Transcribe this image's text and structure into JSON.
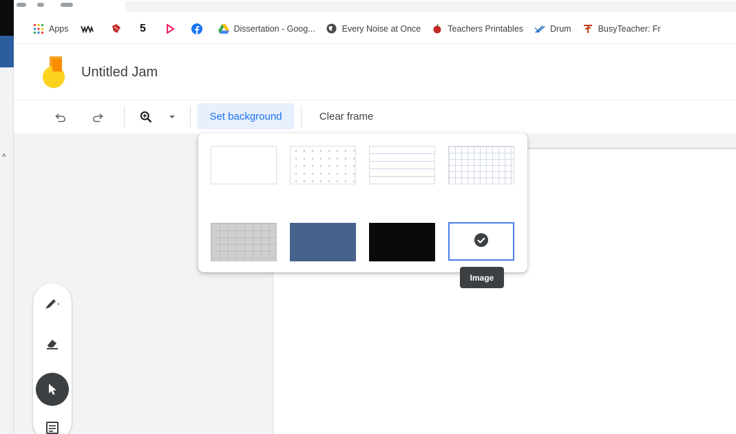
{
  "bookmarks": {
    "items": [
      {
        "label": "Apps",
        "icon": "apps-grid-icon"
      },
      {
        "label": "",
        "icon": "wwe-icon"
      },
      {
        "label": "",
        "icon": "bookmark-red-icon"
      },
      {
        "label": "",
        "icon": "five-icon",
        "glyph": "5"
      },
      {
        "label": "",
        "icon": "play-icon"
      },
      {
        "label": "",
        "icon": "facebook-icon"
      },
      {
        "label": "Dissertation - Goog...",
        "icon": "google-drive-icon"
      },
      {
        "label": "Every Noise at Once",
        "icon": "globe-icon"
      },
      {
        "label": "Teachers Printables",
        "icon": "apple-icon"
      },
      {
        "label": "Drum",
        "icon": "drum-icon"
      },
      {
        "label": "BusyTeacher: Fr",
        "icon": "busyteacher-icon"
      }
    ]
  },
  "header": {
    "title": "Untitled Jam"
  },
  "toolbar": {
    "set_background_label": "Set background",
    "clear_frame_label": "Clear frame"
  },
  "background_picker": {
    "options": [
      "blank",
      "dots",
      "lines",
      "grid",
      "gray-grid",
      "blue",
      "black",
      "image"
    ],
    "selected": "image",
    "tooltip": "Image",
    "colors": {
      "blue": "#47638c",
      "black": "#0a0a0a",
      "selected_border": "#4d7fe8"
    }
  },
  "tools": [
    "pen-icon",
    "eraser-icon",
    "select-icon",
    "sticky-note-icon"
  ],
  "colors": {
    "accent": "#1a73e8",
    "accent_bg": "#e8f0fe"
  }
}
